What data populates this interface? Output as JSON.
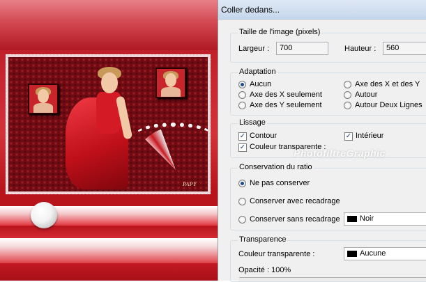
{
  "dialog": {
    "title": "Coller dedans...",
    "watermark": "PhotofiltreGraphic",
    "image_size": {
      "legend": "Taille de l'image (pixels)",
      "width_label": "Largeur :",
      "width_value": "700",
      "height_label": "Hauteur :",
      "height_value": "560"
    },
    "adaptation": {
      "legend": "Adaptation",
      "options": [
        {
          "label": "Aucun",
          "selected": true
        },
        {
          "label": "Axe des X seulement",
          "selected": false
        },
        {
          "label": "Axe des Y seulement",
          "selected": false
        },
        {
          "label": "Axe des X et des Y",
          "selected": false
        },
        {
          "label": "Autour",
          "selected": false
        },
        {
          "label": "Autour Deux Lignes",
          "selected": false
        }
      ]
    },
    "lissage": {
      "legend": "Lissage",
      "contour": "Contour",
      "interieur": "Intérieur",
      "couleur_transparente": "Couleur transparente :"
    },
    "ratio": {
      "legend": "Conservation du ratio",
      "ne_pas_conserver": "Ne pas conserver",
      "avec_recadrage": "Conserver avec recadrage",
      "sans_recadrage": "Conserver sans recadrage",
      "fill_color_name": "Noir"
    },
    "transparence": {
      "legend": "Transparence",
      "color_label": "Couleur transparente :",
      "color_name": "Aucune",
      "opacity_label": "Opacité : 100%"
    }
  },
  "canvas": {
    "signature": "PAPY"
  },
  "colors": {
    "swatch_black": "#000000",
    "canvas_red": "#b8141c",
    "dialog_bg": "#f0f0f0"
  }
}
